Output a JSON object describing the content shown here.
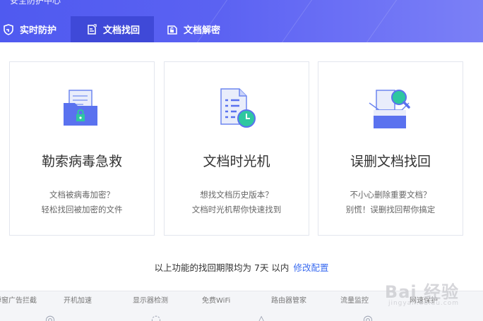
{
  "window": {
    "title": "安全防护中心"
  },
  "tabs": [
    {
      "label": "实时防护",
      "icon": "shield-icon"
    },
    {
      "label": "文档找回",
      "icon": "document-restore-icon",
      "active": true
    },
    {
      "label": "文档解密",
      "icon": "document-unlock-icon"
    }
  ],
  "cards": [
    {
      "title": "勒索病毒急救",
      "line1": "文档被病毒加密？",
      "line2": "轻松找回被加密的文件",
      "icon": "locked-folder-icon"
    },
    {
      "title": "文档时光机",
      "line1": "想找文档历史版本？",
      "line2": "文档时光机帮你快速找到",
      "icon": "document-clock-icon"
    },
    {
      "title": "误删文档找回",
      "line1": "不小心删除重要文档？",
      "line2": "别慌！误删找回帮你搞定",
      "icon": "box-search-icon"
    }
  ],
  "notice": {
    "text": "以上功能的找回期限均为 7天 以内",
    "link": "修改配置"
  },
  "bottom": {
    "labels": [
      "弹窗广告拦截",
      "开机加速",
      "显示器检测",
      "免费WiFi",
      "路由器管家",
      "流量监控",
      "网速保护"
    ]
  },
  "watermark": {
    "text": "Bai 经验",
    "sub": "jingyan.baidu.com"
  },
  "colors": {
    "header": "#5259f0",
    "active_tab": "#3f49d8",
    "link": "#3b6cf0",
    "accent": "#5a7ef0",
    "teal": "#2ec7a0"
  }
}
